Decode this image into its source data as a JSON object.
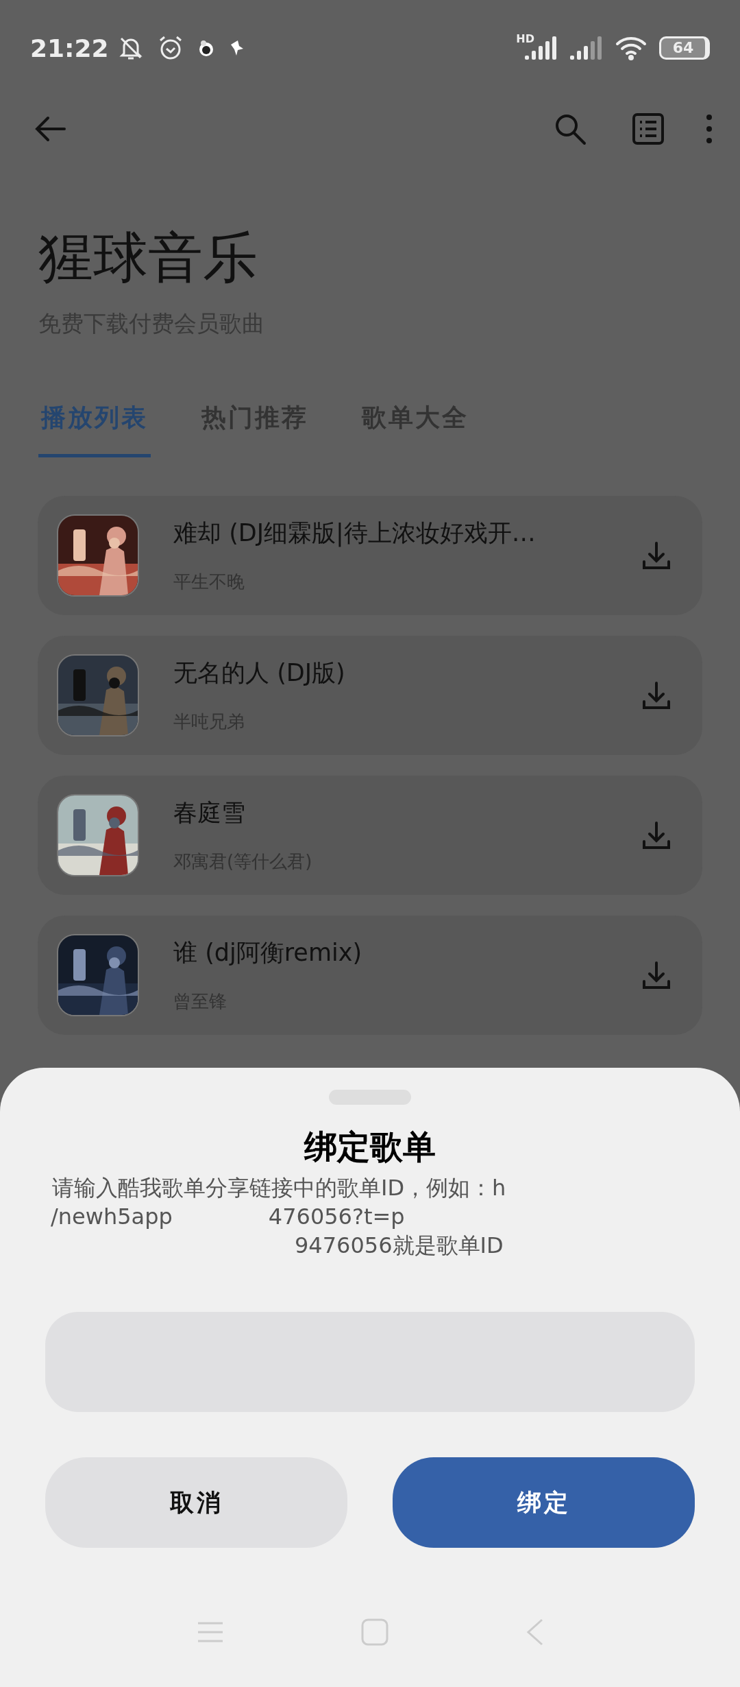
{
  "status_bar": {
    "time": "21:22",
    "network_label": "HD",
    "battery": "64"
  },
  "header": {
    "title": "猩球音乐",
    "subtitle": "免费下载付费会员歌曲"
  },
  "tabs": [
    {
      "label": "播放列表",
      "selected": true
    },
    {
      "label": "热门推荐",
      "selected": false
    },
    {
      "label": "歌单大全",
      "selected": false
    }
  ],
  "songs": [
    {
      "title": "难却 (DJ细霖版|待上浓妆好戏开…",
      "artist": "平生不晚"
    },
    {
      "title": "无名的人 (DJ版)",
      "artist": "半吨兄弟"
    },
    {
      "title": "春庭雪",
      "artist": "邓寓君(等什么君)"
    },
    {
      "title": "谁 (dj阿衡remix)",
      "artist": "曾至锋"
    }
  ],
  "dialog": {
    "title": "绑定歌单",
    "description": [
      [
        "请输入酷我歌单分享链接中的歌单ID，例如：h"
      ],
      [
        "/newh5app",
        "476056?t=p"
      ],
      [
        "9476056就是歌单ID"
      ]
    ],
    "buttons": [
      {
        "label": "取消",
        "kind": "secondary"
      },
      {
        "label": "绑定",
        "kind": "primary"
      }
    ]
  }
}
